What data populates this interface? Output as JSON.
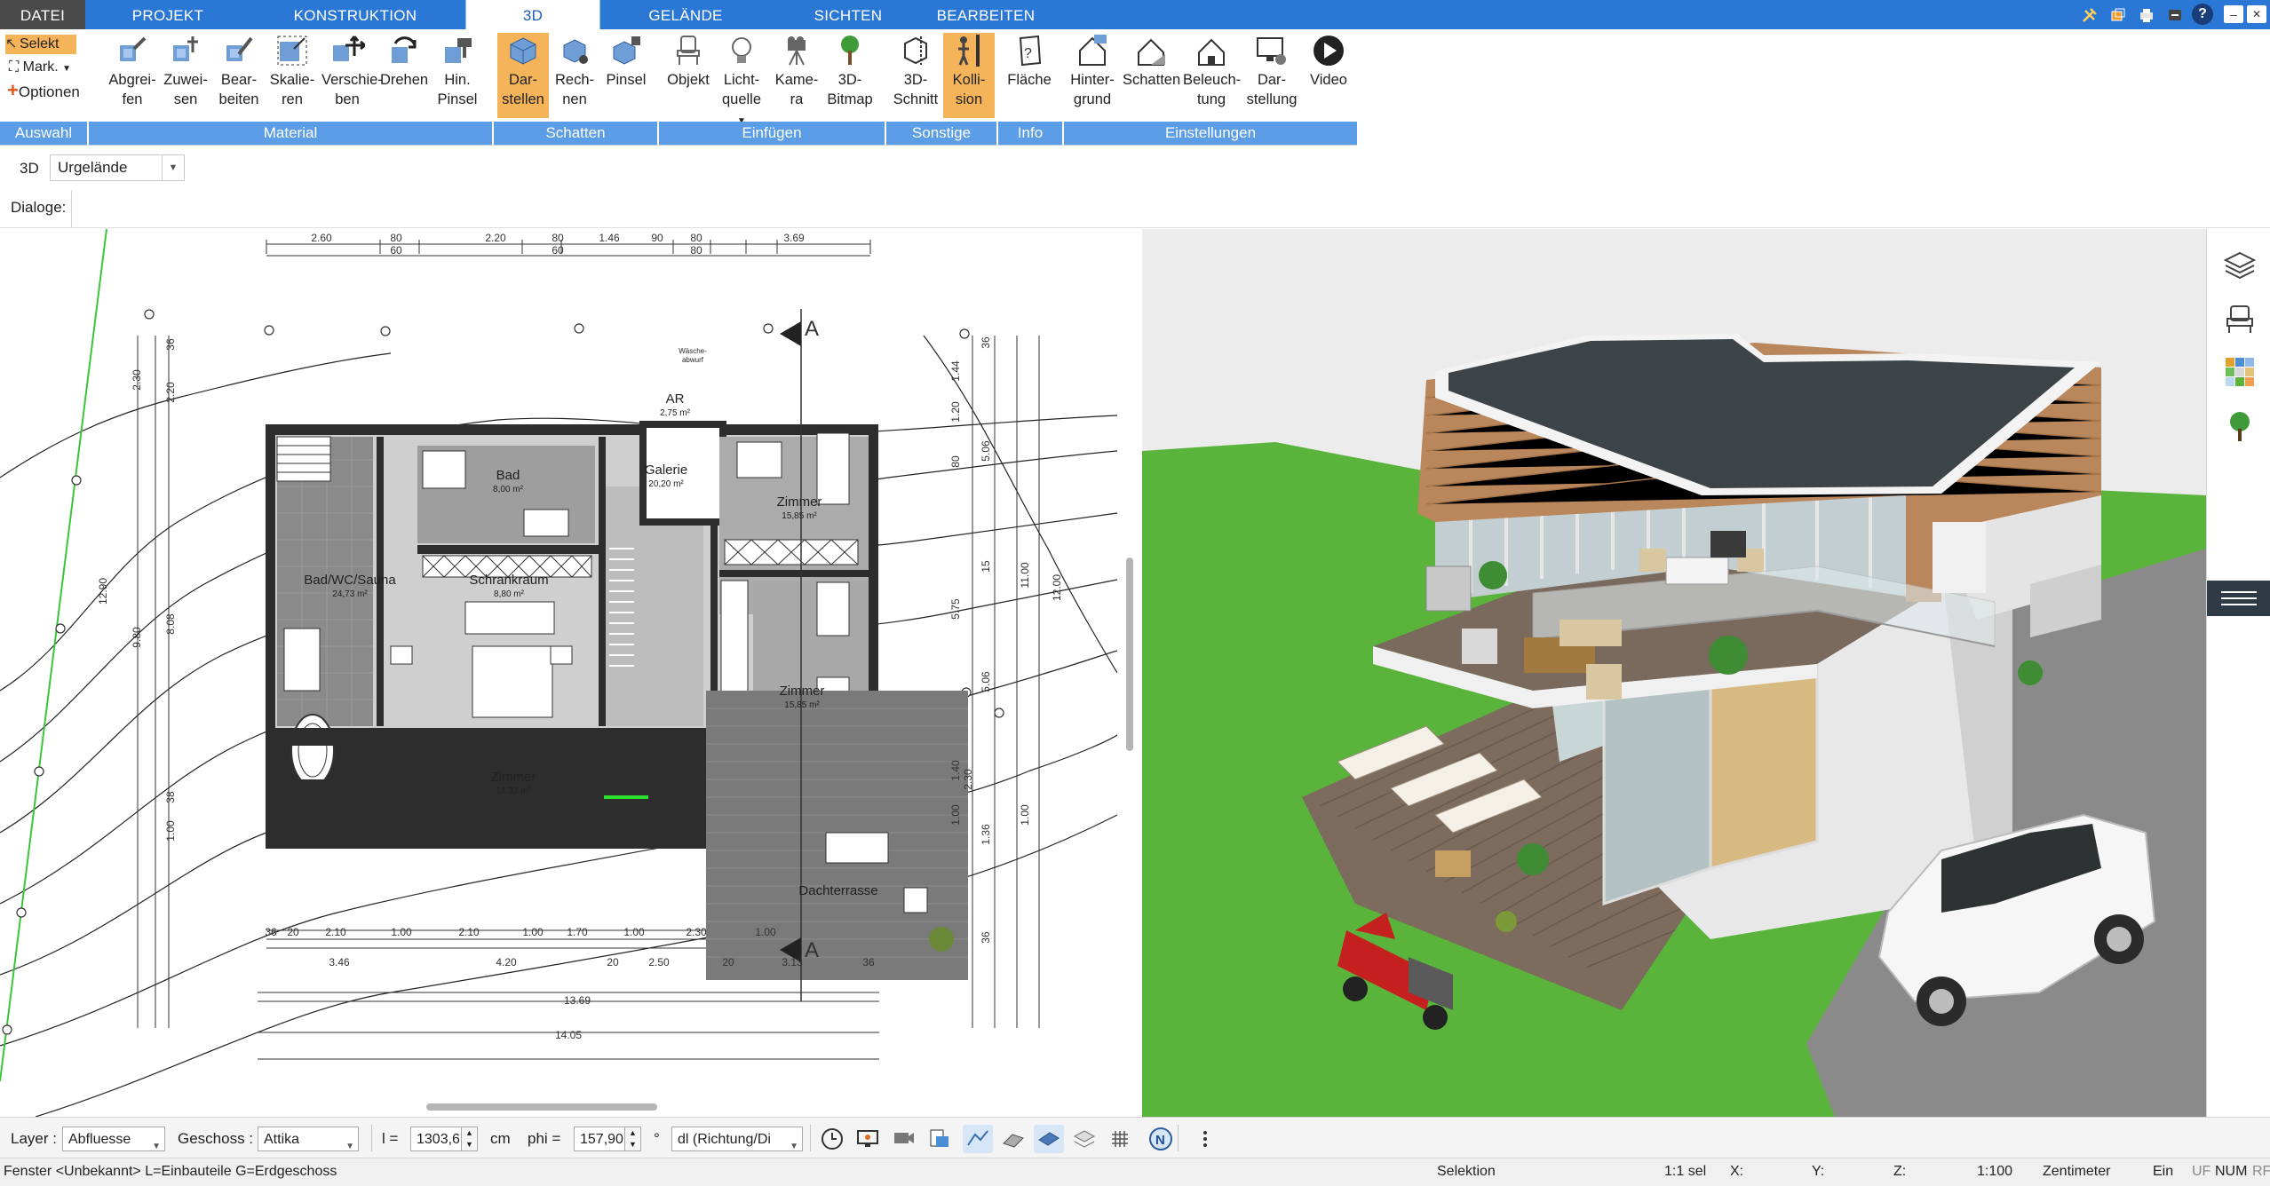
{
  "tabs": {
    "file": "DATEI",
    "projekt": "PROJEKT",
    "konstruktion": "KONSTRUKTION",
    "d3": "3D",
    "gelaende": "GELÄNDE",
    "sichten": "SICHTEN",
    "bearbeiten": "BEARBEITEN"
  },
  "ribbon": {
    "auswahl": {
      "label": "Auswahl",
      "selekt": "Selekt",
      "mark": "Mark.",
      "optionen": "Optionen"
    },
    "material": {
      "label": "Material",
      "abgreifen": [
        "Abgrei-",
        "fen"
      ],
      "zuweisen": [
        "Zuwei-",
        "sen"
      ],
      "bearbeiten": [
        "Bear-",
        "beiten"
      ],
      "skalieren": [
        "Skalie-",
        "ren"
      ],
      "verschieben": [
        "Verschie-",
        "ben"
      ],
      "drehen": [
        "Drehen",
        ""
      ],
      "hinpinsel": [
        "Hin.",
        "Pinsel"
      ]
    },
    "schatten": {
      "label": "Schatten",
      "darstellen": [
        "Dar-",
        "stellen"
      ],
      "rechnen": [
        "Rech-",
        "nen"
      ],
      "pinsel": [
        "Pinsel",
        ""
      ]
    },
    "einfuegen": {
      "label": "Einfügen",
      "objekt": [
        "Objekt",
        ""
      ],
      "lichtquelle": [
        "Licht-",
        "quelle"
      ],
      "kamera": [
        "Kame-",
        "ra"
      ],
      "bitmap": [
        "3D-",
        "Bitmap"
      ]
    },
    "sonstige": {
      "label": "Sonstige",
      "schnitt": [
        "3D-",
        "Schnitt"
      ],
      "kollision": [
        "Kolli-",
        "sion"
      ]
    },
    "info": {
      "label": "Info",
      "flaeche": [
        "Fläche",
        ""
      ]
    },
    "einstellungen": {
      "label": "Einstellungen",
      "hintergrund": [
        "Hinter-",
        "grund"
      ],
      "schatten": [
        "Schatten",
        ""
      ],
      "beleuchtung": [
        "Beleuch-",
        "tung"
      ],
      "darstellung": [
        "Dar-",
        "stellung"
      ],
      "video": [
        "Video",
        ""
      ]
    }
  },
  "toolbar2": {
    "mode": "3D",
    "terrain_select": "Urgelände"
  },
  "toolbar3": {
    "dialoge_label": "Dialoge:"
  },
  "plan": {
    "rooms": [
      {
        "name": "Bad",
        "area": "8,00 m²"
      },
      {
        "name": "Galerie",
        "area": "20,20 m²"
      },
      {
        "name": "AR",
        "area": "2,75 m²"
      },
      {
        "name": "Zimmer",
        "area": "15,85 m²"
      },
      {
        "name": "Bad/WC/Sauna",
        "area": "24,73 m²"
      },
      {
        "name": "Schrankraum",
        "area": "8,80 m²"
      },
      {
        "name": "Zimmer",
        "area": "15,85 m²"
      },
      {
        "name": "Zimmer",
        "area": "14,32 m²"
      },
      {
        "name": "Dachterrasse",
        "area": ""
      }
    ],
    "waesche": [
      "Wäsche-",
      "abwurf"
    ],
    "top_dims": [
      "2.60",
      "80",
      "60",
      "2.20",
      "80",
      "60",
      "1.46",
      "90",
      "80",
      "80",
      "3.69"
    ],
    "bottom_dims1": [
      "36",
      "20",
      "2.10",
      "1.00",
      "2.10",
      "1.00",
      "1.70",
      "1.00",
      "2.30",
      "1.00"
    ],
    "bottom_dims2": [
      "3.46",
      "4.20",
      "20",
      "2.50",
      "20",
      "3.13",
      "36"
    ],
    "bottom_dims3": [
      "13.69"
    ],
    "bottom_dims4": [
      "14.05"
    ],
    "left_dims": [
      "2.30",
      "2.20",
      "36",
      "8.08",
      "9.80",
      "12.90",
      "38",
      "1.00"
    ],
    "right_dims": [
      "36",
      "1.44",
      "1.20",
      "80",
      "5.06",
      "15",
      "5.75",
      "11.00",
      "12.00",
      "5.06",
      "1.40",
      "2.30",
      "1.00",
      "1.36",
      "1.00",
      "36"
    ],
    "section_marks": [
      "A",
      "A"
    ]
  },
  "bottombar": {
    "layer_label": "Layer :",
    "layer_value": "Abfluesse",
    "geschoss_label": "Geschoss :",
    "geschoss_value": "Attika",
    "l_label": "l =",
    "l_value": "1303,6",
    "l_unit": "cm",
    "phi_label": "phi =",
    "phi_value": "157,90",
    "phi_unit": "°",
    "dl_value": "dl (Richtung/Di"
  },
  "statusbar": {
    "left": "Fenster <Unbekannt> L=Einbauteile G=Erdgeschoss",
    "mode": "Selektion",
    "sel": "1:1 sel",
    "x": "X:",
    "y": "Y:",
    "z": "Z:",
    "scale": "1:100",
    "unit": "Zentimeter",
    "ein": "Ein",
    "uf": "UF",
    "num": "NUM",
    "rf": "RF"
  },
  "colors": {
    "tabbar": "#2b77d6",
    "group_label": "#5b9de6",
    "active_button": "#f5b35a",
    "lawn": "#5ab43c",
    "roof": "#3c4448",
    "wood": "#b9875b"
  }
}
